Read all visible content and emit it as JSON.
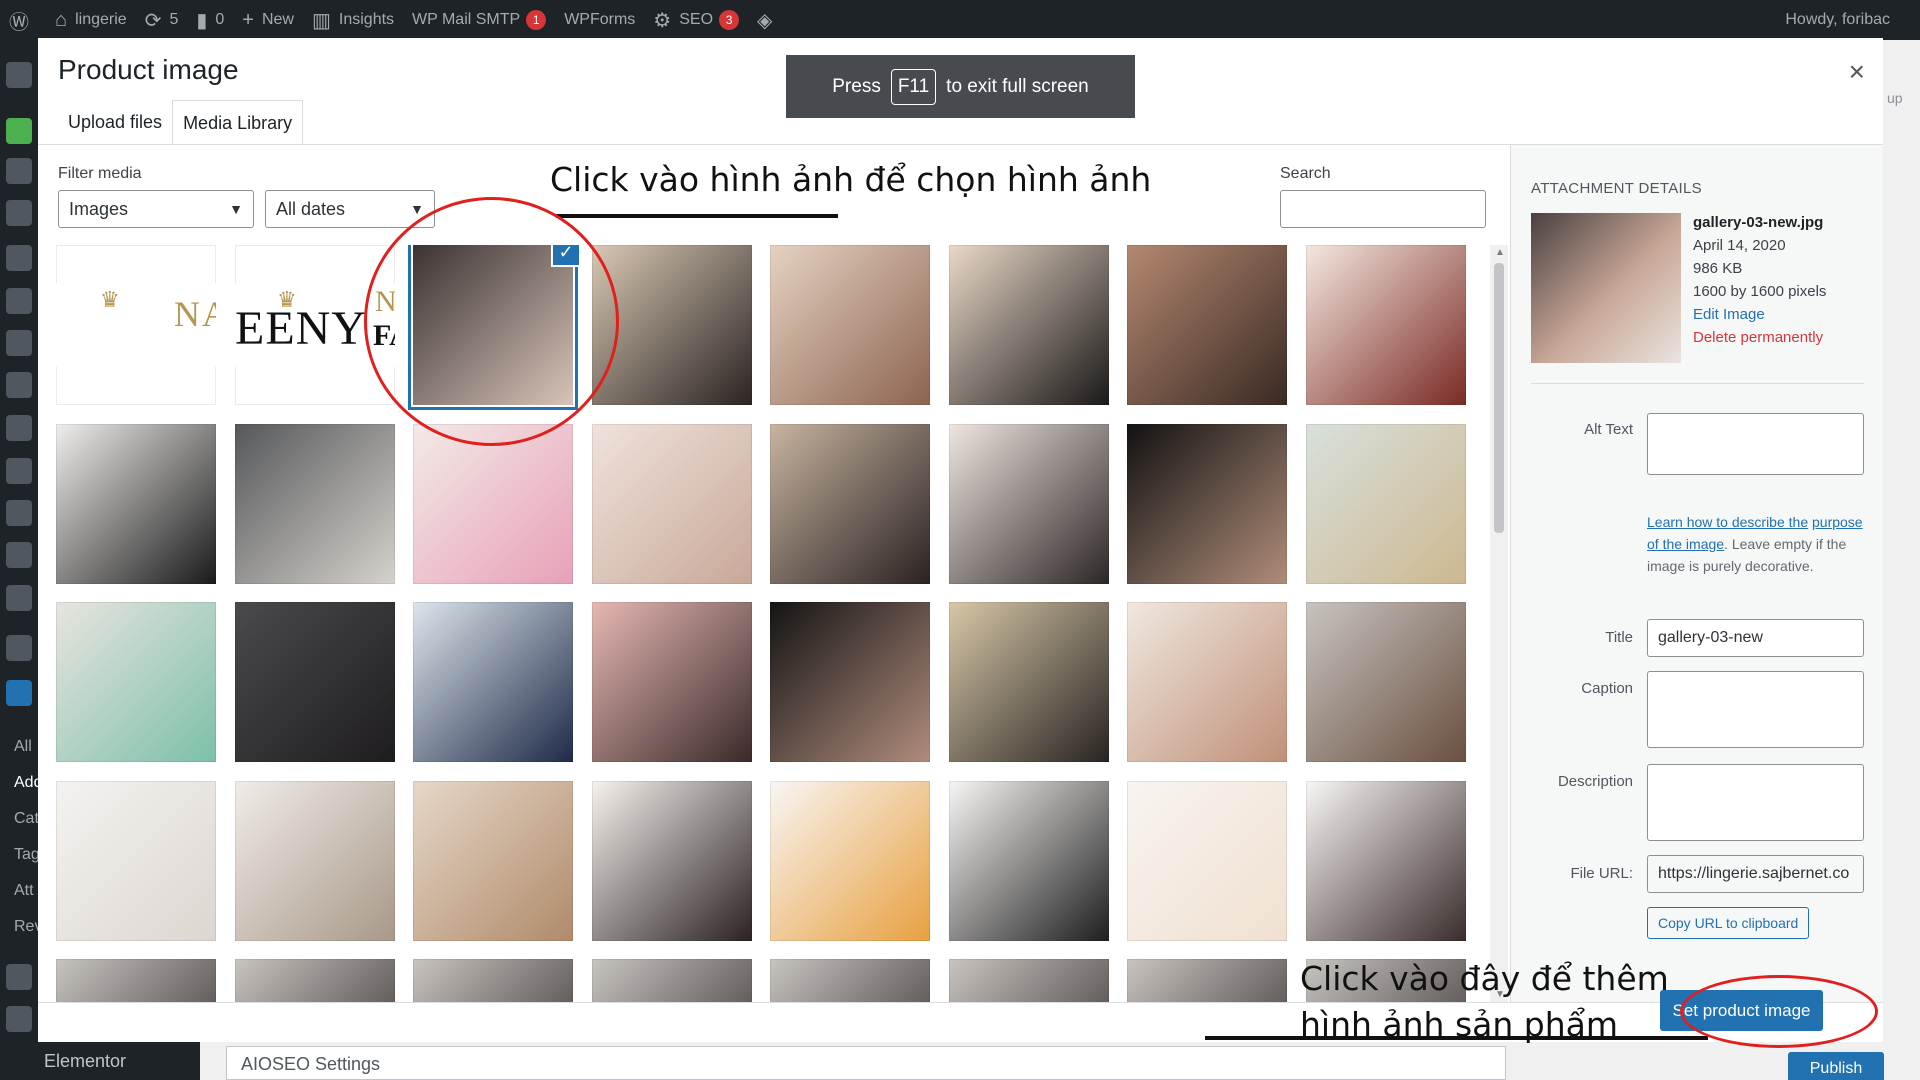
{
  "admin_bar": {
    "site_name": "lingerie",
    "updates": "5",
    "comments": "0",
    "new_label": "New",
    "insights": "Insights",
    "wp_mail": "WP Mail SMTP",
    "wp_mail_badge": "1",
    "wpforms": "WPForms",
    "seo": "SEO",
    "seo_badge": "3",
    "howdy": "Howdy, foribac"
  },
  "left_menu": {
    "items": [
      "All",
      "Add",
      "Cat",
      "Tag",
      "Att",
      "Rev"
    ],
    "elementor": "Elementor"
  },
  "background": {
    "aioseo": "AIOSEO Settings",
    "publish": "Publish",
    "right_label": "up"
  },
  "fullscreen_hint": {
    "press": "Press",
    "key": "F11",
    "rest": "to exit full screen"
  },
  "modal": {
    "title": "Product image",
    "tabs": [
      {
        "label": "Upload files",
        "active": false
      },
      {
        "label": "Media Library",
        "active": true
      }
    ],
    "filter_label": "Filter media",
    "type_select": "Images",
    "date_select": "All dates",
    "search_label": "Search",
    "search_value": "",
    "footer_button": "Set product image"
  },
  "media_grid": {
    "logo_texts": {
      "crown": "♛",
      "na": "NA",
      "eeny": "EENY",
      "fas": "FAS"
    },
    "selected_index": 2,
    "thumb_colors": [
      [
        "#ffffff",
        "#ffffff"
      ],
      [
        "#ffffff",
        "#ffffff"
      ],
      [
        "#3a3232",
        "#d8c4b8"
      ],
      [
        "#d9c8b4",
        "#2a2422"
      ],
      [
        "#e6d2c2",
        "#8c6450"
      ],
      [
        "#ead9c8",
        "#1a1818"
      ],
      [
        "#b48870",
        "#3a2a24"
      ],
      [
        "#f4e8e0",
        "#7a2a24"
      ],
      [
        "#f0eeec",
        "#1a1a1a"
      ],
      [
        "#55575a",
        "#d6d2cc"
      ],
      [
        "#f2eae6",
        "#e8a0b8"
      ],
      [
        "#f0e2dc",
        "#c8a898"
      ],
      [
        "#c8b4a0",
        "#2a2222"
      ],
      [
        "#efe6e0",
        "#2c2626"
      ],
      [
        "#121212",
        "#b08c78"
      ],
      [
        "#d8e0dc",
        "#cdb890"
      ],
      [
        "#e8e4e0",
        "#7cc0a8"
      ],
      [
        "#4a4a4c",
        "#1e1c1e"
      ],
      [
        "#dde6ec",
        "#1e2a48"
      ],
      [
        "#e6b8b4",
        "#3a2a28"
      ],
      [
        "#141414",
        "#b08c7c"
      ],
      [
        "#d8c8a8",
        "#282422"
      ],
      [
        "#f0e8e0",
        "#c09078"
      ],
      [
        "#c8c4c0",
        "#6a5040"
      ],
      [
        "#f4f2f0",
        "#dcd6d0"
      ],
      [
        "#f0ece8",
        "#a89888"
      ],
      [
        "#e6d8c8",
        "#b08a6a"
      ],
      [
        "#f6f2ee",
        "#2a2222"
      ],
      [
        "#f8f6f4",
        "#e8a040"
      ],
      [
        "#f8f6f4",
        "#1e1e1e"
      ],
      [
        "#f8f4f0",
        "#f0e0d0"
      ],
      [
        "#f8f6f4",
        "#3a2c2c"
      ]
    ]
  },
  "attachment": {
    "heading": "ATTACHMENT DETAILS",
    "filename": "gallery-03-new.jpg",
    "date": "April 14, 2020",
    "size": "986 KB",
    "dimensions": "1600 by 1600 pixels",
    "edit": "Edit Image",
    "delete": "Delete permanently",
    "alt_label": "Alt Text",
    "help_link1": "Learn how to describe the",
    "help_link2": "purpose of the image",
    "help_text": ". Leave empty if the image is purely decorative.",
    "title_label": "Title",
    "title_value": "gallery-03-new",
    "caption_label": "Caption",
    "description_label": "Description",
    "url_label": "File URL:",
    "url_value": "https://lingerie.sajbernet.co",
    "copy_button": "Copy URL to clipboard"
  },
  "annotations": {
    "top": "Click vào hình ảnh để chọn hình ảnh",
    "bottom_line1": "Click vào đây để thêm",
    "bottom_line2": "hình ảnh sản phẩm"
  }
}
